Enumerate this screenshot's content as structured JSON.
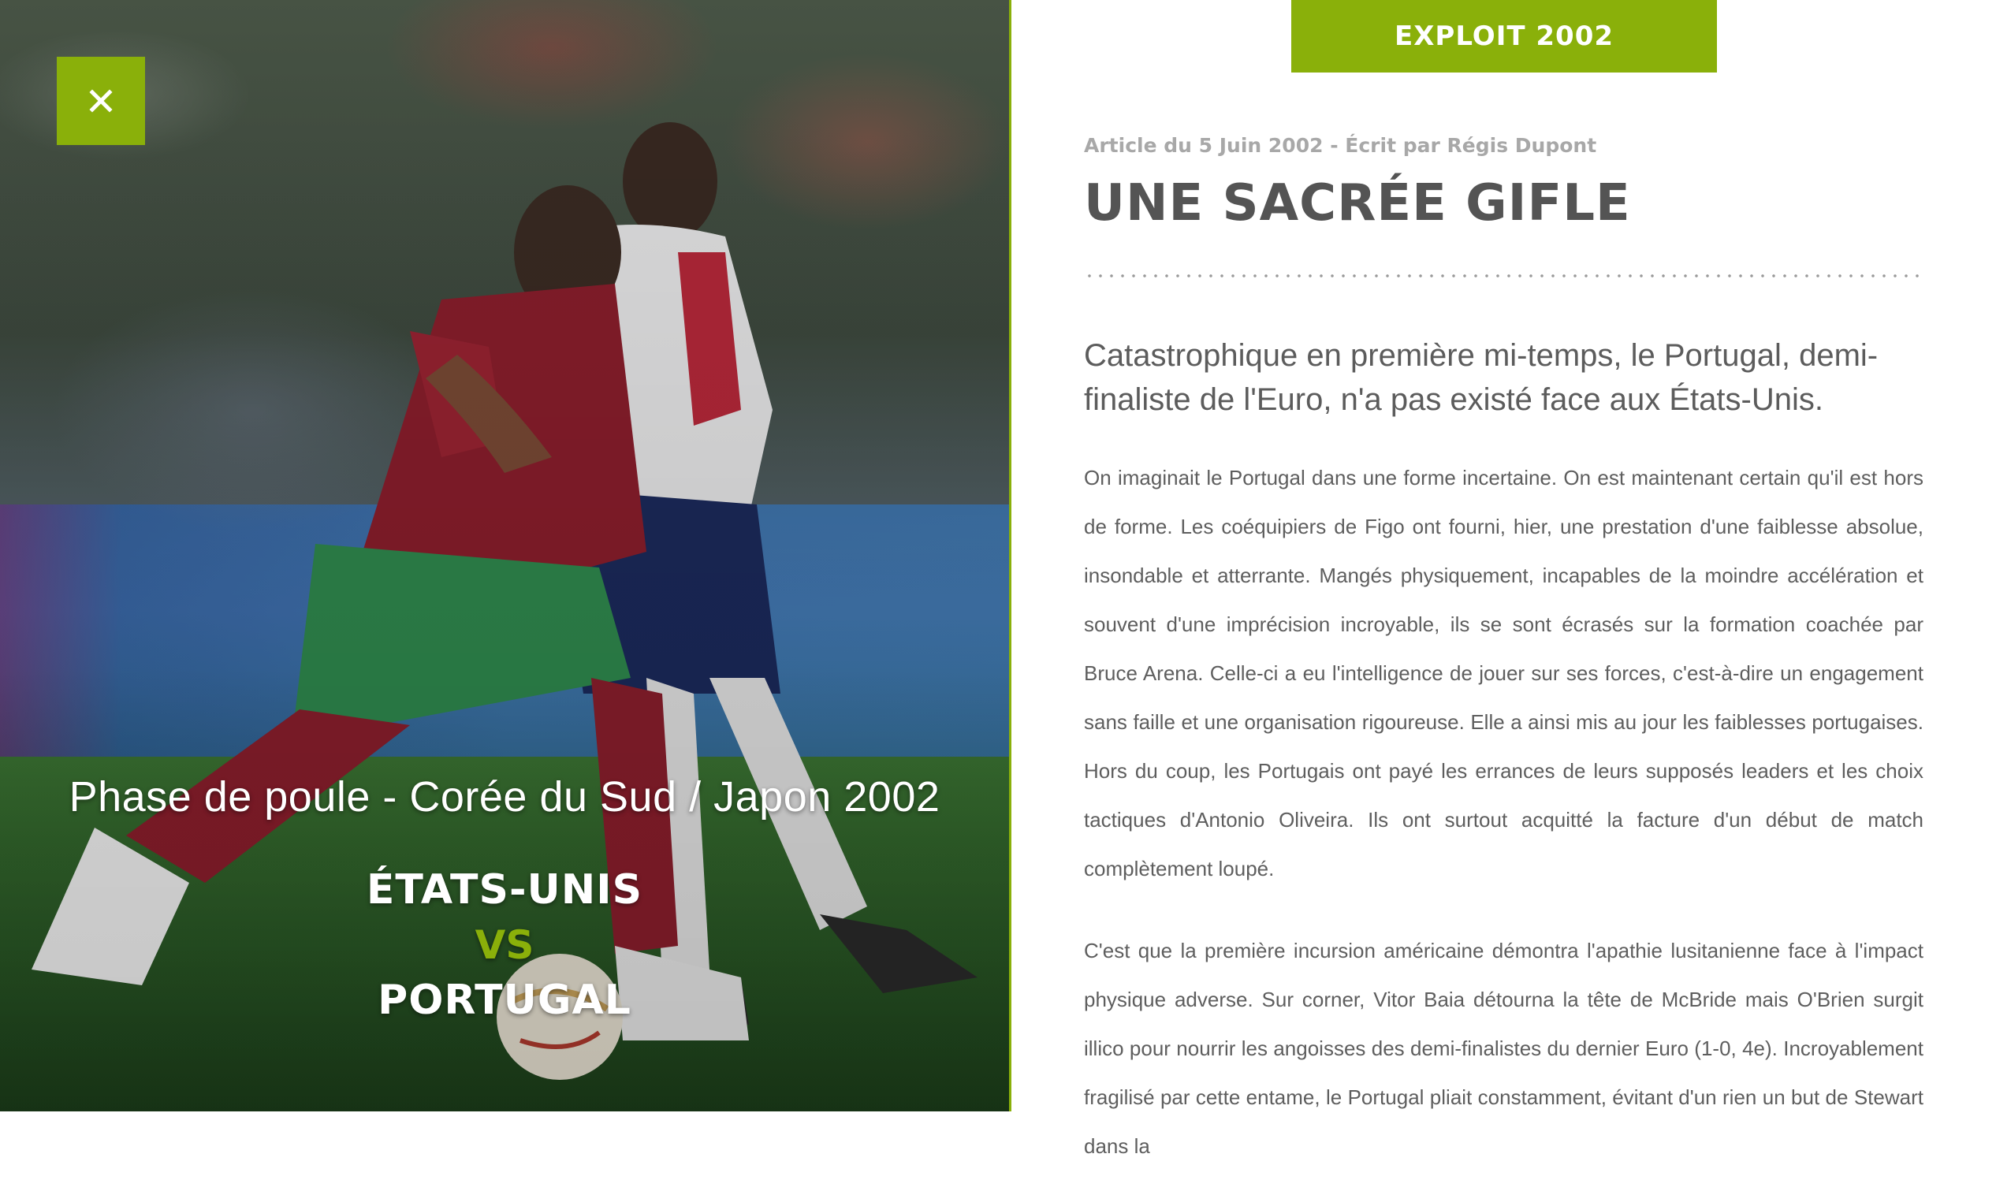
{
  "left": {
    "close_icon": "close-icon",
    "phase": "Phase de poule - Corée du Sud / Japon 2002",
    "team_home": "ÉTATS-UNIS",
    "vs": "VS",
    "team_away": "PORTUGAL"
  },
  "right": {
    "category": "EXPLOIT 2002",
    "meta": "Article du 5 Juin 2002 - Écrit par Régis Dupont",
    "title": "UNE SACRÉE GIFLE",
    "lead": "Catastrophique en première mi-temps, le Portugal, demi-finaliste de l'Euro, n'a pas existé face aux États-Unis.",
    "paragraphs": [
      "On imaginait le Portugal dans une forme incertaine. On est maintenant certain qu'il est hors de forme. Les coéquipiers de Figo ont fourni, hier, une prestation d'une faiblesse absolue, insondable et atterrante. Mangés physiquement, incapables de la moindre accélération et souvent d'une imprécision incroyable, ils se sont écrasés sur la formation coachée par Bruce Arena. Celle-ci a eu l'intelligence de jouer sur ses forces, c'est-à-dire un engagement sans faille et une organisation rigoureuse. Elle a ainsi mis au jour les faiblesses portugaises. Hors du coup, les Portugais ont payé les errances de leurs supposés leaders et les choix tactiques d'Antonio Oliveira. Ils ont surtout acquitté la facture d'un début de match complètement loupé.",
      "C'est que la première incursion américaine démontra l'apathie lusitanienne face à l'impact physique adverse. Sur corner, Vitor Baia détourna la tête de McBride mais O'Brien surgit illico pour nourrir les angoisses des demi-finalistes du dernier Euro (1-0, 4e). Incroyablement fragilisé par cette entame, le Portugal pliait constamment, évitant d'un rien un but de Stewart dans la"
    ]
  },
  "colors": {
    "accent": "#8ab00a",
    "title": "#545454",
    "meta": "#a8a8a8",
    "body": "#5e5e5e"
  }
}
